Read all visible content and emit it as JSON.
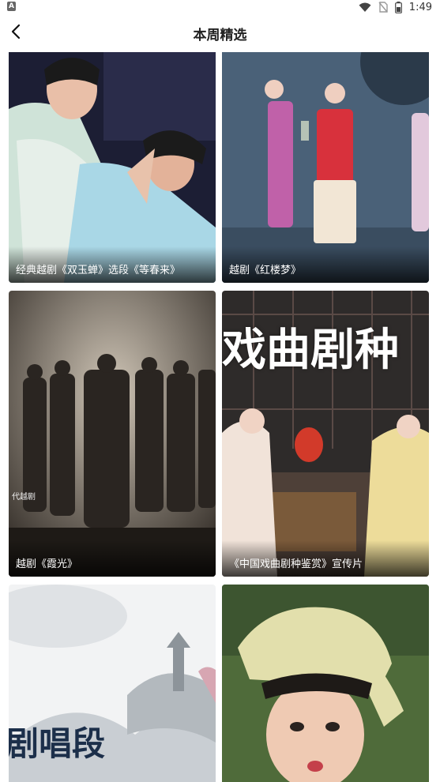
{
  "status_bar": {
    "left_badge": "A",
    "time": "1:49",
    "icons": [
      "wifi-icon",
      "sim-off-icon",
      "battery-icon"
    ]
  },
  "app_bar": {
    "back_icon": "chevron-left-icon",
    "title": "本周精选"
  },
  "feed": {
    "items": [
      {
        "caption": "经典越剧《双玉蝉》选段《等春来》"
      },
      {
        "caption": "越剧《红楼梦》"
      },
      {
        "caption": "越剧《霞光》"
      },
      {
        "caption": "《中国戏曲剧种鉴赏》宣传片"
      },
      {
        "caption": "",
        "poster_text": "剧唱段"
      },
      {
        "caption": ""
      }
    ],
    "decor_texts": {
      "c3_logo": "代越剧",
      "c4_banner": "戏曲剧种"
    }
  },
  "colors": {
    "background": "#ffffff",
    "caption_text": "#ffffff",
    "title_text": "#222222"
  }
}
